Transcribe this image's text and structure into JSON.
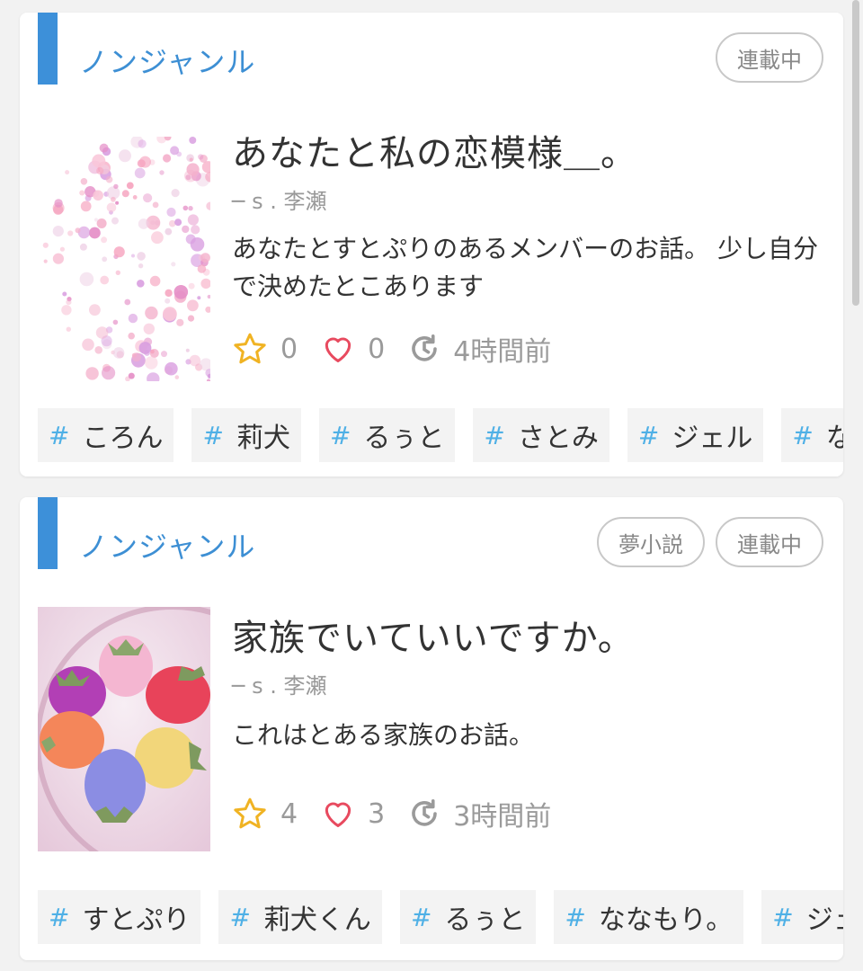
{
  "colors": {
    "accent": "#3d90d9",
    "genre_text": "#3d8fd4",
    "hash": "#4fb0e6",
    "star": "#f0b323",
    "heart": "#e84a5f"
  },
  "cards": [
    {
      "genre": "ノンジャンル",
      "badges": [
        "連載中"
      ],
      "title": "あなたと私の恋模様＿。",
      "author": "─ s . 李瀬",
      "description": "あなたとすとぷりのあるメンバーのお話。 少し自分で決めたとこあります",
      "stars": "0",
      "hearts": "0",
      "updated": "4時間前",
      "thumb": "cherry-blossom-image",
      "tags": [
        "ころん",
        "莉犬",
        "るぅと",
        "さとみ",
        "ジェル",
        "なな"
      ]
    },
    {
      "genre": "ノンジャンル",
      "badges": [
        "夢小説",
        "連載中"
      ],
      "title": "家族でいていいですか。",
      "author": "─ s . 李瀬",
      "description": "これはとある家族のお話。",
      "stars": "4",
      "hearts": "3",
      "updated": "3時間前",
      "thumb": "strawberries-image",
      "tags": [
        "すとぷり",
        "莉犬くん",
        "るぅと",
        "ななもり。",
        "ジェ"
      ]
    }
  ],
  "icons": {
    "star": "star-icon",
    "heart": "heart-icon",
    "clock": "clock-icon",
    "hash": "#"
  }
}
